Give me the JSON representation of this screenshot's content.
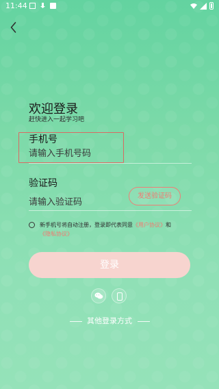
{
  "status_bar": {
    "time": "11:44"
  },
  "login": {
    "title": "欢迎登录",
    "subtitle": "赶快进入一起学习吧",
    "phone_label": "手机号",
    "phone_placeholder": "请输入手机号码",
    "code_label": "验证码",
    "code_placeholder": "请输入验证码",
    "send_code": "发送验证码",
    "agreement_prefix": "新手机号将自动注册，登录即代表同意",
    "user_agreement": "《用户协议》",
    "and_text": "和",
    "privacy_policy": "《隐私协议》",
    "login_button": "登录",
    "other_login": "其他登录方式"
  },
  "icons": {
    "back": "back-arrow-icon",
    "wechat": "wechat-icon",
    "phone": "phone-icon",
    "wifi": "wifi-icon",
    "signal": "signal-icon",
    "battery": "battery-icon"
  },
  "colors": {
    "accent": "#f27a70",
    "button_bg": "#f7d4cf",
    "background_top": "#63d3a0",
    "background_bottom": "#95e2b9"
  }
}
